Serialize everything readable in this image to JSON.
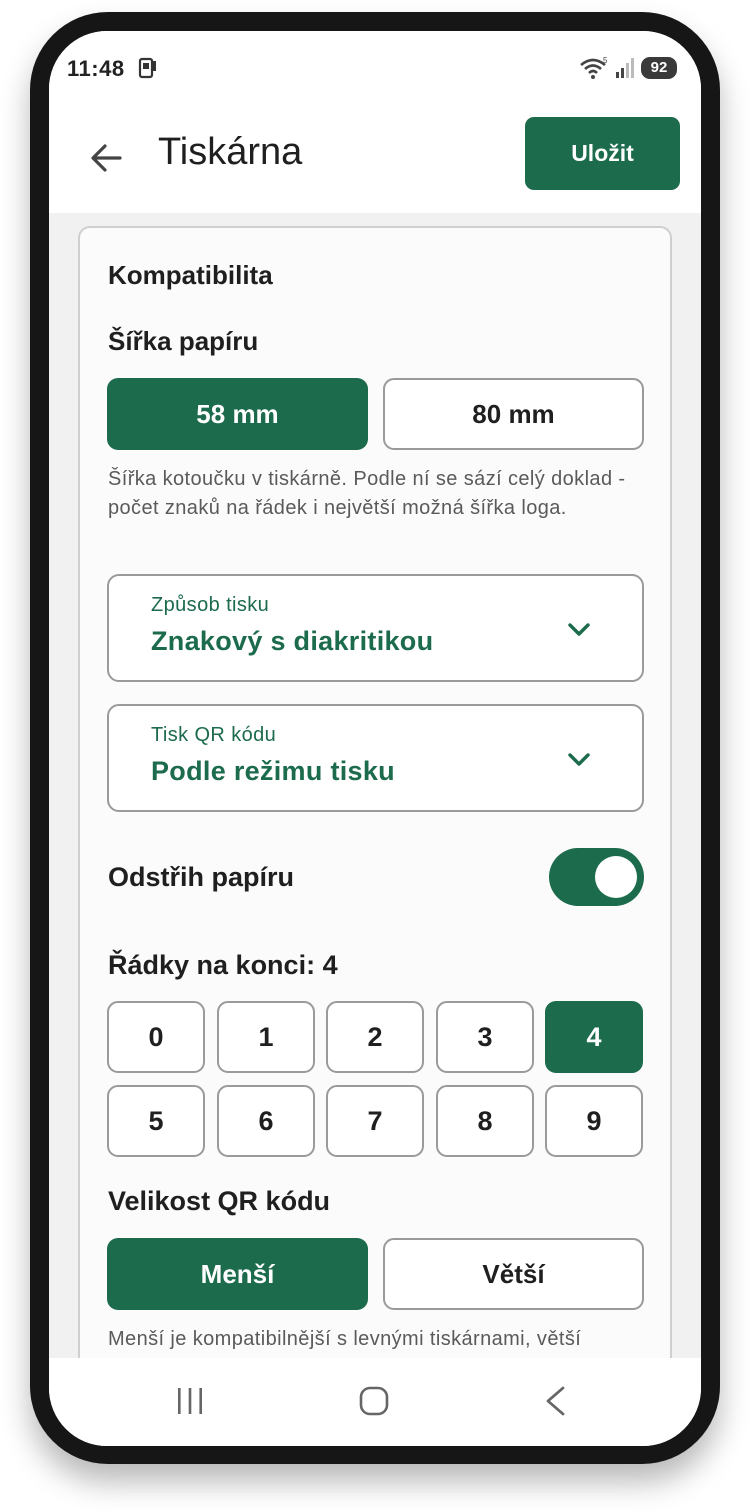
{
  "status": {
    "time": "11:48",
    "battery": "92"
  },
  "appbar": {
    "title": "Tiskárna",
    "save_label": "Uložit"
  },
  "card": {
    "heading": "Kompatibilita",
    "paper_width": {
      "label": "Šířka papíru",
      "options": [
        "58 mm",
        "80 mm"
      ],
      "selected": "58 mm",
      "help": "Šířka kotoučku v tiskárně. Podle ní se sází celý doklad - počet znaků na řádek i největší možná šířka loga."
    },
    "print_mode": {
      "label": "Způsob tisku",
      "value": "Znakový s diakritikou"
    },
    "qr_print": {
      "label": "Tisk QR kódu",
      "value": "Podle režimu tisku"
    },
    "paper_cut": {
      "label": "Odstřih papíru",
      "enabled": true
    },
    "end_lines": {
      "label": "Řádky na konci: 4",
      "options": [
        "0",
        "1",
        "2",
        "3",
        "4",
        "5",
        "6",
        "7",
        "8",
        "9"
      ],
      "selected": "4"
    },
    "qr_size": {
      "label": "Velikost QR kódu",
      "options": [
        "Menší",
        "Větší"
      ],
      "selected": "Menší",
      "help": "Menší je kompatibilnější s levnými tiskárnami, větší"
    }
  },
  "colors": {
    "accent": "#1c6b4c",
    "border": "#9a9a9a",
    "background": "#f1f1f1"
  }
}
